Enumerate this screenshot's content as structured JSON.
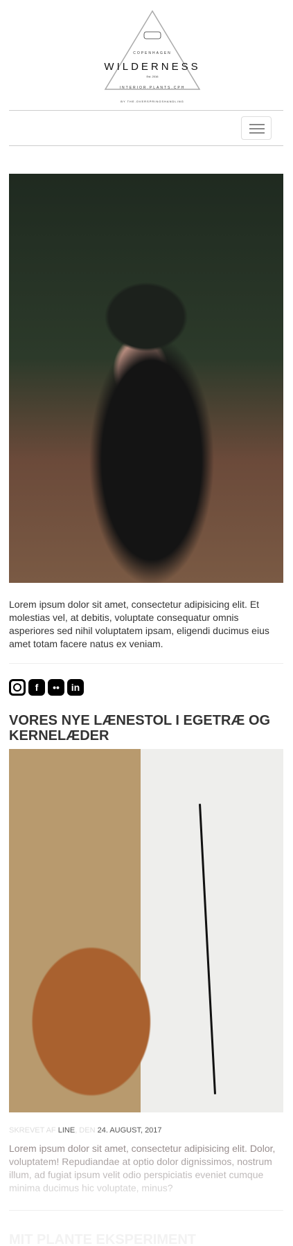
{
  "logo": {
    "top": "COPENHAGEN",
    "name": "WILDERNESS",
    "est": "Est. 2016",
    "tagline": "INTERIOR.PLANTS.CPH",
    "by": "BY THE.OVERSPRINGSHANDLING"
  },
  "nav": {
    "toggle_label": "Toggle navigation"
  },
  "intro": {
    "text": "Lorem ipsum dolor sit amet, consectetur adipisicing elit. Et molestias vel, at debitis, voluptate consequatur omnis asperiores sed nihil voluptatem ipsam, eligendi ducimus eius amet totam facere natus ex veniam."
  },
  "social": [
    "instagram-icon",
    "facebook-icon",
    "flickr-icon",
    "linkedin-icon"
  ],
  "posts": [
    {
      "title": "VORES NYE LÆNESTOL I EGETRÆ OG KERNELÆDER",
      "written_by_label": "SKREVET AF",
      "author": "LINE",
      "date_label": ", DEN",
      "date": "24. AUGUST, 2017",
      "excerpt": "Lorem ipsum dolor sit amet, consectetur adipisicing elit. Dolor, voluptatem! Repudiandae at optio dolor dignissimos, nostrum illum, ad fugiat ipsum velit odio perspiciatis eveniet cumque minima ducimus hic voluptate, minus?"
    },
    {
      "title": "MIT PLANTE EKSPERIMENT"
    }
  ]
}
